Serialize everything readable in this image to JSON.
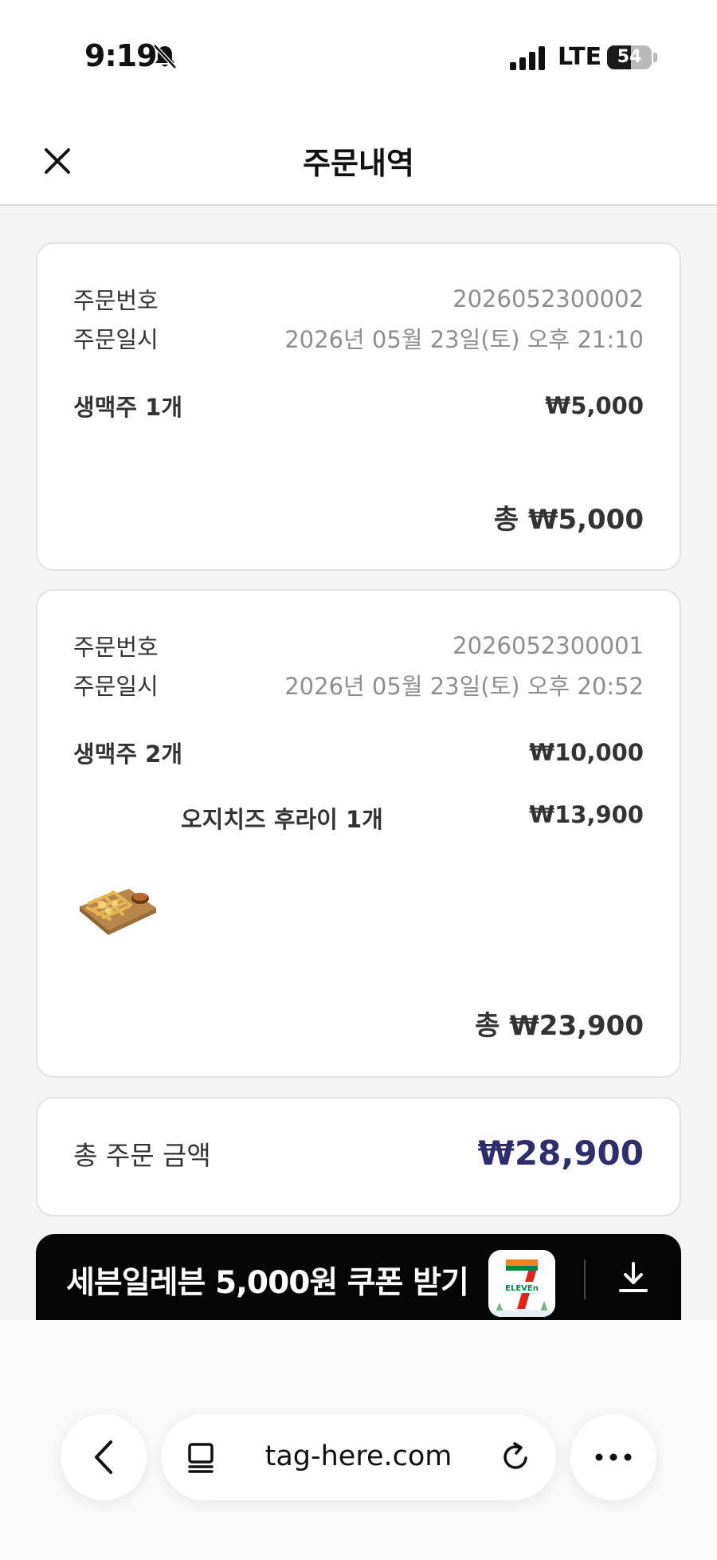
{
  "status_bar": {
    "time": "9:19",
    "network": "LTE",
    "battery": "54",
    "battery_level": 0.54
  },
  "header": {
    "title": "주문내역",
    "close_icon": "close-icon"
  },
  "orders": [
    {
      "order_no_label": "주문번호",
      "order_no": "2026052300002",
      "order_date_label": "주문일시",
      "order_date": "2026년 05월 23일(토) 오후 21:10",
      "items": [
        {
          "name": "생맥주 1개",
          "price": "₩5,000"
        }
      ],
      "total": "총 ₩5,000"
    },
    {
      "order_no_label": "주문번호",
      "order_no": "2026052300001",
      "order_date_label": "주문일시",
      "order_date": "2026년 05월 23일(토) 오후 20:52",
      "items": [
        {
          "name": "생맥주 2개",
          "price": "₩10,000"
        },
        {
          "name": "오지치즈 후라이 1개",
          "price": "₩13,900",
          "thumbnail": "fries-image"
        }
      ],
      "total": "총 ₩23,900"
    }
  ],
  "summary": {
    "label": "총 주문 금액",
    "amount": "₩28,900"
  },
  "banner": {
    "text": "세븐일레븐 5,000원 쿠폰 받기",
    "logo_text": "ELEVEn",
    "logo_number": "7",
    "download_icon": "download-icon"
  },
  "browser": {
    "url": "tag-here.com",
    "back_icon": "chevron-left-icon",
    "tabs_icon": "tabs-icon",
    "reload_icon": "reload-icon",
    "more_icon": "more-icon"
  },
  "colors": {
    "accent": "#2d2e6b",
    "banner_bg": "#050505",
    "seven_green": "#00864a",
    "seven_orange": "#f58220",
    "seven_red": "#e2231a"
  }
}
